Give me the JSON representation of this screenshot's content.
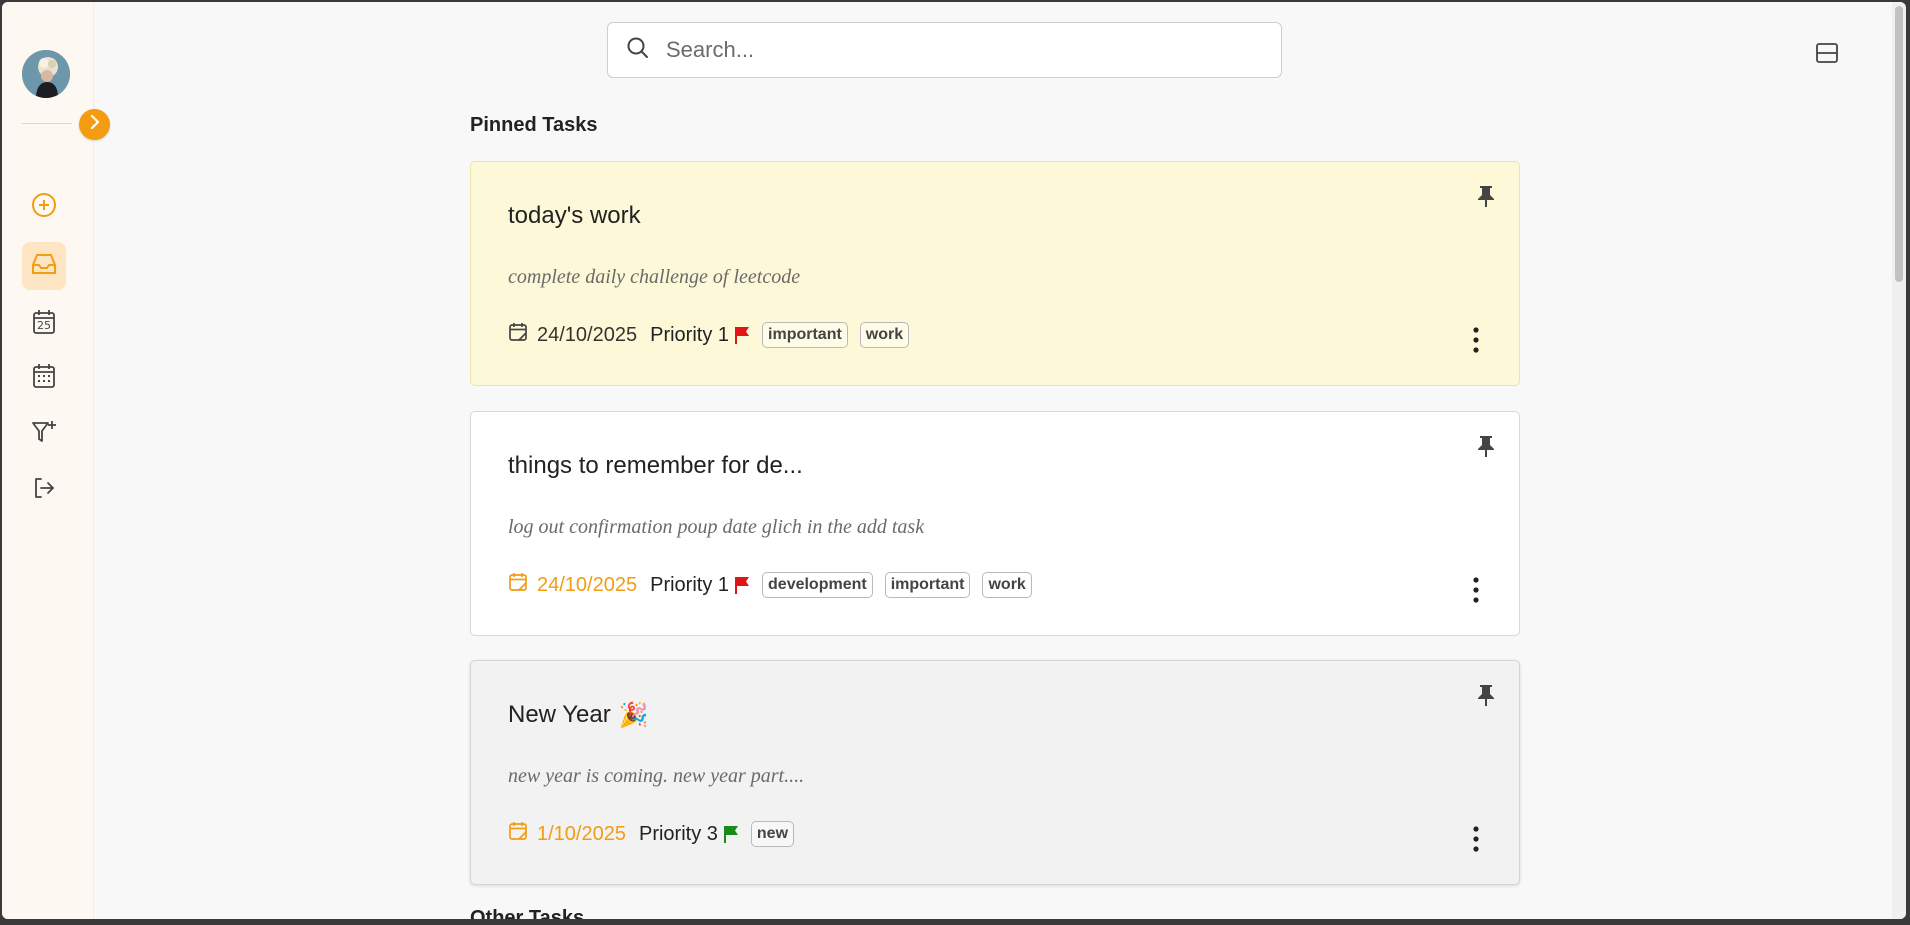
{
  "search": {
    "placeholder": "Search..."
  },
  "sections": {
    "pinned_title": "Pinned Tasks",
    "other_title": "Other Tasks"
  },
  "colors": {
    "accent": "#f39c12",
    "priority_high": "#e01515",
    "priority_low": "#1a8a1a"
  },
  "sidebar": {
    "items": [
      {
        "name": "add-task",
        "icon": "plus-circle-icon"
      },
      {
        "name": "inbox",
        "icon": "inbox-icon",
        "active": true
      },
      {
        "name": "today",
        "icon": "calendar-day-icon"
      },
      {
        "name": "upcoming",
        "icon": "calendar-grid-icon"
      },
      {
        "name": "filters",
        "icon": "filter-plus-icon"
      },
      {
        "name": "logout",
        "icon": "logout-icon"
      }
    ],
    "today_day_number": "25"
  },
  "tasks": [
    {
      "title": "today's work",
      "description": "complete daily challenge of leetcode",
      "date": "24/10/2025",
      "priority": "Priority 1",
      "tags": [
        "important",
        "work"
      ]
    },
    {
      "title": "things to remember for de...",
      "description": "log out confirmation poup date glich in the add task",
      "date": "24/10/2025",
      "priority": "Priority 1",
      "tags": [
        "development",
        "important",
        "work"
      ]
    },
    {
      "title": "New Year",
      "emoji": "🎉",
      "description": "new year is coming. new year part....",
      "date": "1/10/2025",
      "priority": "Priority 3",
      "tags": [
        "new"
      ]
    }
  ]
}
